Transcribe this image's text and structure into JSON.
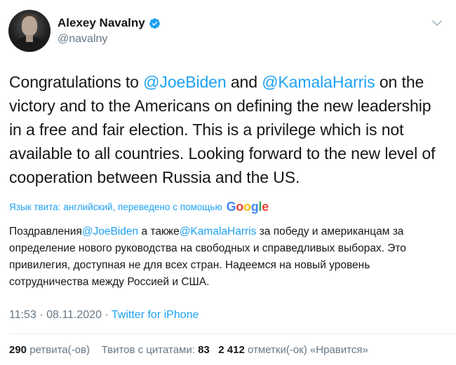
{
  "user": {
    "display_name": "Alexey Navalny",
    "handle": "@navalny"
  },
  "tweet": {
    "segments": [
      {
        "text": "Congratulations to ",
        "type": "text"
      },
      {
        "text": "@JoeBiden",
        "type": "mention"
      },
      {
        "text": " and ",
        "type": "text"
      },
      {
        "text": "@KamalaHarris",
        "type": "mention"
      },
      {
        "text": " on the victory and to the Americans on defining the new leadership in a free and fair election. This is a privilege which is not available to all countries. Looking forward to the new level of cooperation between Russia and the US.",
        "type": "text"
      }
    ]
  },
  "translation": {
    "label": "Язык твита: английский, переведено с помощью",
    "provider": "Google",
    "segments": [
      {
        "text": "Поздравления",
        "type": "text"
      },
      {
        "text": "@JoeBiden",
        "type": "mention"
      },
      {
        "text": " а также",
        "type": "text"
      },
      {
        "text": "@KamalaHarris",
        "type": "mention"
      },
      {
        "text": " за победу и американцам за определение нового руководства на свободных и справедливых выборах. Это привилегия, доступная не для всех стран. Надеемся на новый уровень сотрудничества между Россией и США.",
        "type": "text"
      }
    ]
  },
  "meta": {
    "time": "11:53",
    "separator": " · ",
    "date": "08.11.2020",
    "source": "Twitter for iPhone"
  },
  "stats": {
    "retweets_count": "290",
    "retweets_label": " ретвита(-ов)",
    "quotes_label": "Твитов с цитатами: ",
    "quotes_count": "83",
    "likes_count": "2 412",
    "likes_label": " отметки(-ок) «Нравится»"
  },
  "colors": {
    "accent": "#1da1f2",
    "secondary_text": "#657786",
    "primary_text": "#14171a"
  },
  "icons": {
    "verified": "verified-badge-icon",
    "menu": "chevron-down-icon"
  }
}
